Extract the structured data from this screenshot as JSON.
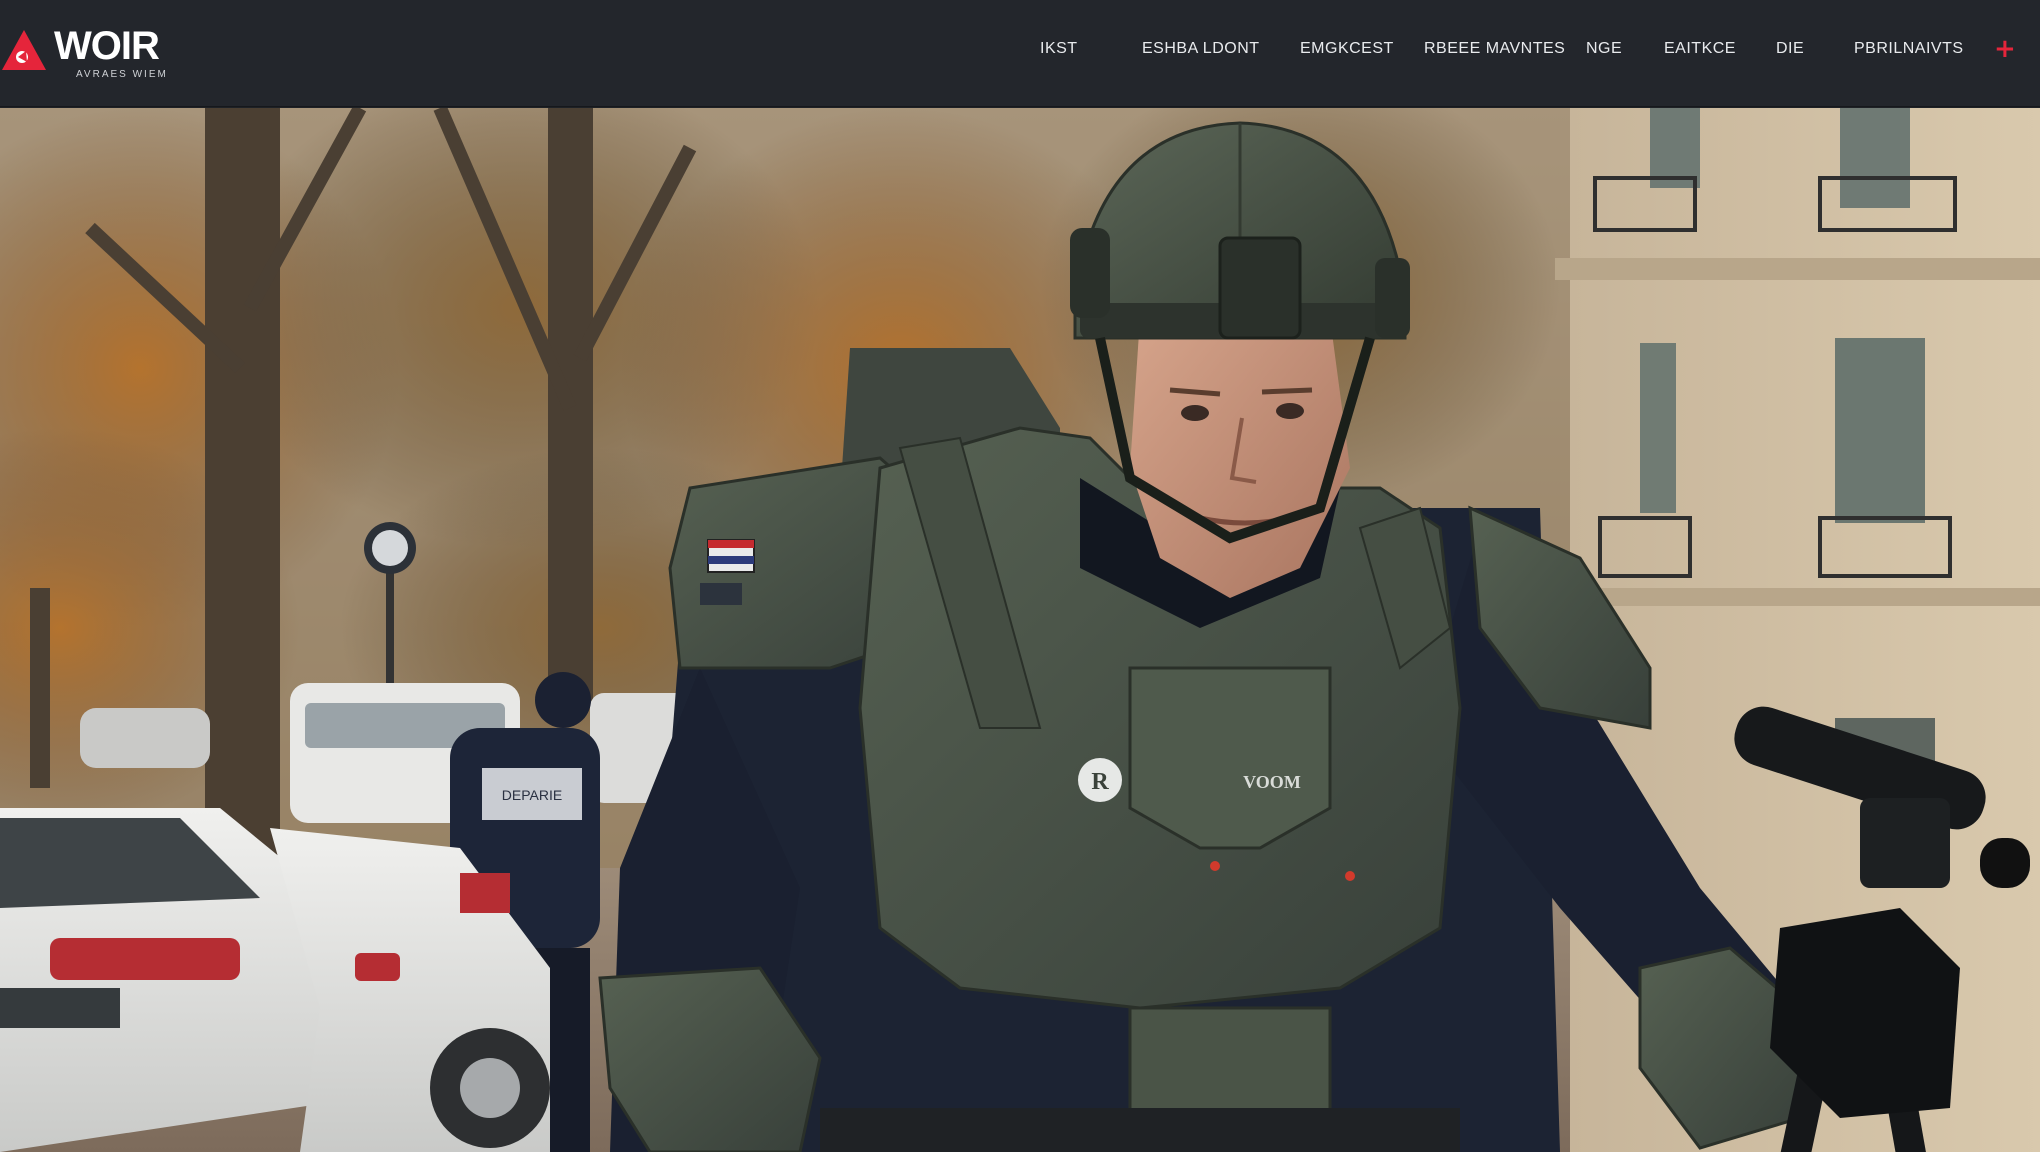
{
  "brand": {
    "name": "WOIR",
    "tagline": "AVRAES WIEM",
    "accent_color": "#e5253b",
    "logo_icon": "warning-triangle-icon"
  },
  "nav": {
    "items": [
      {
        "label": "IKST"
      },
      {
        "label": "ESHBA LDONT"
      },
      {
        "label": "EMGKCEST"
      },
      {
        "label": "RBEEE MAVNTES"
      },
      {
        "label": "NGE"
      },
      {
        "label": "EAITKCE"
      },
      {
        "label": "DIE"
      },
      {
        "label": "PBRILNAIVTS"
      }
    ],
    "plus_icon": "plus-icon"
  },
  "hero": {
    "chest_text": "VOOM",
    "vest_icon": "r-emblem-icon",
    "van_sign": "DEPARIE"
  },
  "colors": {
    "topbar": "#23262c",
    "armor": "#4a5447",
    "undersuit": "#1c2333"
  }
}
